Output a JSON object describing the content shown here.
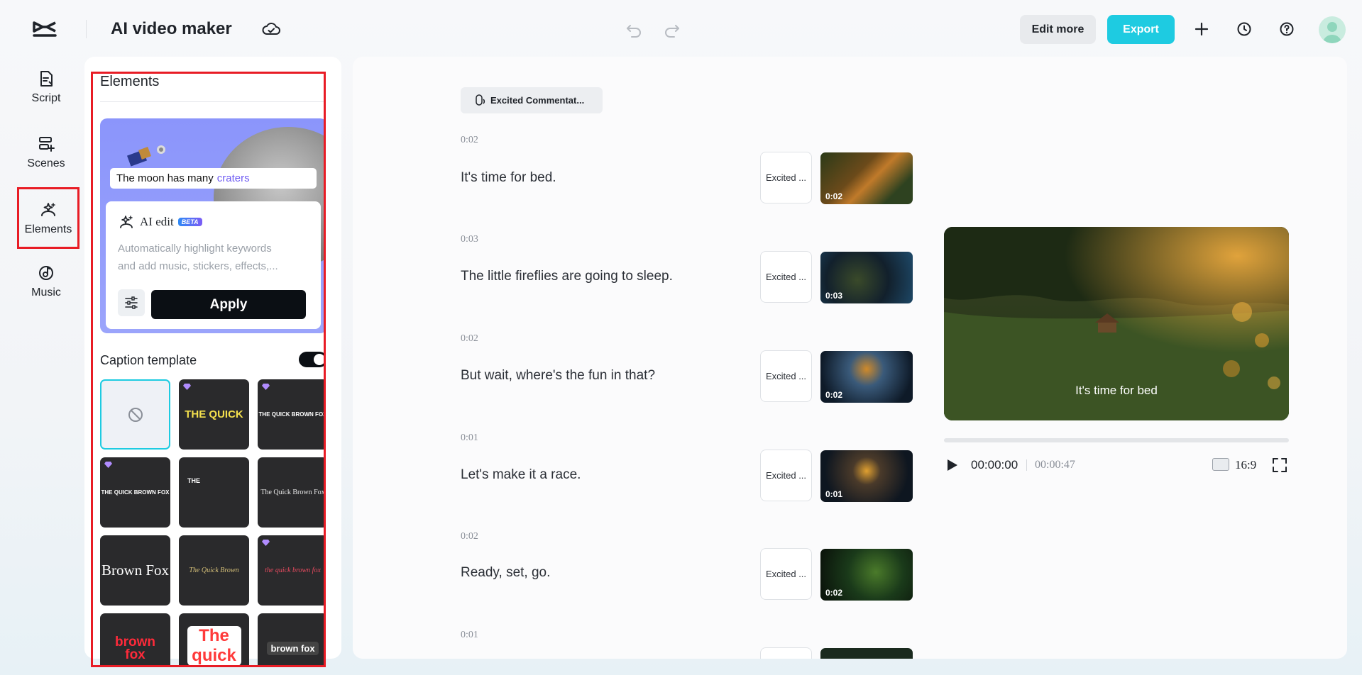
{
  "header": {
    "app_title": "AI video maker",
    "edit_more_label": "Edit more",
    "export_label": "Export"
  },
  "sidebar": {
    "items": [
      {
        "label": "Script",
        "icon": "script-icon"
      },
      {
        "label": "Scenes",
        "icon": "scenes-icon"
      },
      {
        "label": "Elements",
        "icon": "elements-icon",
        "active": true
      },
      {
        "label": "Music",
        "icon": "music-icon"
      }
    ]
  },
  "elements_panel": {
    "title": "Elements",
    "hero_caption_prefix": "The moon has many",
    "hero_caption_highlight": "craters",
    "ai_edit": {
      "title": "AI edit",
      "badge": "BETA",
      "description_line1": "Automatically highlight keywords",
      "description_line2": "and add music, stickers, effects,...",
      "apply_label": "Apply"
    },
    "caption_template": {
      "label": "Caption template",
      "enabled": true,
      "tiles": [
        {
          "text": "",
          "style": "none",
          "premium": false
        },
        {
          "text": "THE QUICK",
          "premium": true
        },
        {
          "text": "THE QUICK BROWN FOX",
          "premium": true
        },
        {
          "text": "THE QUICK BROWN FOX",
          "premium": true
        },
        {
          "text": "THE",
          "premium": false
        },
        {
          "text": "The Quick Brown Fox",
          "premium": false
        },
        {
          "text": "Brown Fox",
          "premium": false
        },
        {
          "text": "The Quick Brown",
          "premium": false
        },
        {
          "text": "the quick brown fox",
          "premium": true
        },
        {
          "text": "brown fox",
          "premium": false
        },
        {
          "text": "The quick",
          "premium": false
        },
        {
          "text": "brown fox",
          "premium": false
        }
      ]
    }
  },
  "script": {
    "voice_label": "Excited Commentat...",
    "scenes": [
      {
        "duration": "0:02",
        "text": "It's time for bed.",
        "voice": "Excited ...",
        "thumb_duration": "0:02"
      },
      {
        "duration": "0:03",
        "text": "The little fireflies are going to sleep.",
        "voice": "Excited ...",
        "thumb_duration": "0:03"
      },
      {
        "duration": "0:02",
        "text": "But wait, where's the fun in that?",
        "voice": "Excited ...",
        "thumb_duration": "0:02"
      },
      {
        "duration": "0:01",
        "text": "Let's make it a race.",
        "voice": "Excited ...",
        "thumb_duration": "0:01"
      },
      {
        "duration": "0:02",
        "text": "Ready, set, go.",
        "voice": "Excited ...",
        "thumb_duration": "0:02"
      },
      {
        "duration": "0:01",
        "text": "",
        "voice": "",
        "thumb_duration": ""
      }
    ]
  },
  "preview": {
    "caption": "It's time for bed",
    "current_time": "00:00:00",
    "total_time": "00:00:47",
    "aspect_ratio": "16:9",
    "progress": 0
  },
  "colors": {
    "accent": "#1ecbe1",
    "highlight_border": "#e81c25",
    "primary_dark": "#0b0f14"
  }
}
